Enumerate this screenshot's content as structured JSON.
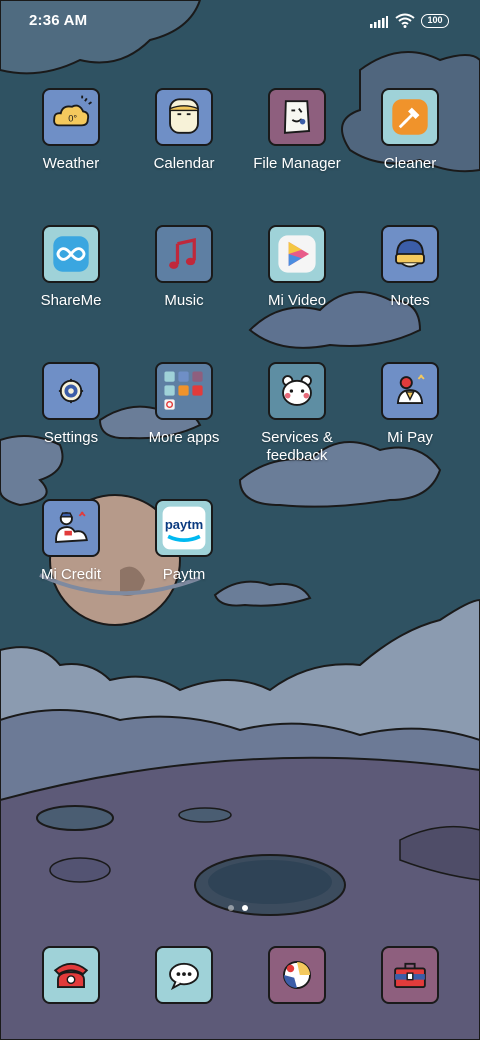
{
  "status_bar": {
    "time": "2:36 AM",
    "battery": "100",
    "icons": [
      "signal-icon",
      "wifi-icon",
      "battery-icon"
    ]
  },
  "apps": [
    {
      "label": "Weather",
      "icon": "weather-icon",
      "color": "#6f8fc6"
    },
    {
      "label": "Calendar",
      "icon": "calendar-icon",
      "color": "#6f8fc6"
    },
    {
      "label": "File Manager",
      "icon": "file-manager-icon",
      "color": "#8e5f7e"
    },
    {
      "label": "Cleaner",
      "icon": "cleaner-icon",
      "color": "#9fd2d8"
    },
    {
      "label": "ShareMe",
      "icon": "shareme-icon",
      "color": "#9fd2d8"
    },
    {
      "label": "Music",
      "icon": "music-icon",
      "color": "#5e7fa3"
    },
    {
      "label": "Mi Video",
      "icon": "mi-video-icon",
      "color": "#9fd2d8"
    },
    {
      "label": "Notes",
      "icon": "notes-icon",
      "color": "#6f8fc6"
    },
    {
      "label": "Settings",
      "icon": "settings-icon",
      "color": "#6f8fc6"
    },
    {
      "label": "More apps",
      "icon": "folder-icon",
      "color": "#5e7fa3"
    },
    {
      "label": "Services & feedback",
      "icon": "services-feedback-icon",
      "color": "#5e8ea3"
    },
    {
      "label": "Mi Pay",
      "icon": "mi-pay-icon",
      "color": "#6f8fc6"
    },
    {
      "label": "Mi Credit",
      "icon": "mi-credit-icon",
      "color": "#6f8fc6"
    },
    {
      "label": "Paytm",
      "icon": "paytm-icon",
      "color": "#9fd2d8",
      "tile_text": "paytm"
    }
  ],
  "dock": [
    {
      "icon": "phone-icon",
      "color": "#9fd2d8"
    },
    {
      "icon": "messages-icon",
      "color": "#9fd2d8"
    },
    {
      "icon": "browser-icon",
      "color": "#8e5f7e"
    },
    {
      "icon": "toolbox-icon",
      "color": "#8e5f7e"
    }
  ],
  "page_indicator": {
    "pages": 2,
    "current": 2
  },
  "colors": {
    "sky": "#2f5262",
    "cloud": "#8b9bb0",
    "ground": "#5d5a78",
    "outline": "#1a1a1a"
  }
}
